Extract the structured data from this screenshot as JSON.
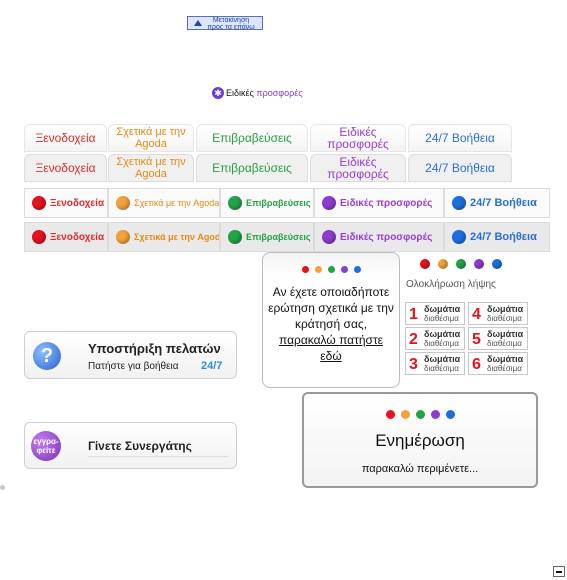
{
  "move_up": {
    "line1": "Μετακίνηση",
    "line2": "προς τα επάνω"
  },
  "special_offers": {
    "part1": "Ειδικές",
    "part2": "προσφορές"
  },
  "nav": {
    "hotels": "Ξενοδοχεία",
    "about_line1": "Σχετικά με την",
    "about_line2": "Agoda",
    "reviews": "Επιβραβεύσεις",
    "offers_line1": "Ειδικές",
    "offers_line2": "προσφορές",
    "help": "24/7 Βοήθεια",
    "about_full": "Σχετικά με την Agoda",
    "offers_full": "Ειδικές προσφορές"
  },
  "question": {
    "text": "Αν έχετε οποιαδήποτε ερώτηση σχετικά με την κράτησή σας,",
    "link": "παρακαλώ πατήστε εδώ"
  },
  "full": {
    "title": "Ολοκλήρωση λήψης",
    "rooms": [
      {
        "num": "1",
        "t1": "δωμάτια",
        "t2": "διαθέσιμα"
      },
      {
        "num": "4",
        "t1": "δωμάτια",
        "t2": "διαθέσιμα"
      },
      {
        "num": "2",
        "t1": "δωμάτια",
        "t2": "διαθέσιμα"
      },
      {
        "num": "5",
        "t1": "δωμάτια",
        "t2": "διαθέσιμα"
      },
      {
        "num": "3",
        "t1": "δωμάτια",
        "t2": "διαθέσιμα"
      },
      {
        "num": "6",
        "t1": "δωμάτια",
        "t2": "διαθέσιμα"
      }
    ]
  },
  "support": {
    "title": "Υποστήριξη πελατών",
    "subtitle": "Πατήστε για βοήθεια",
    "hours": "24/7",
    "icon": "?"
  },
  "partner": {
    "title": "Γίνετε Συνεργάτης",
    "icon_line1": "εγγρα-",
    "icon_line2": "φείτε"
  },
  "update": {
    "title": "Ενημέρωση",
    "subtitle": "παρακαλώ περιμένετε..."
  },
  "colors": {
    "red": "#e4141f",
    "orange": "#f2a23a",
    "green": "#22a447",
    "purple": "#8e3ccf",
    "blue": "#1d6fe0"
  }
}
